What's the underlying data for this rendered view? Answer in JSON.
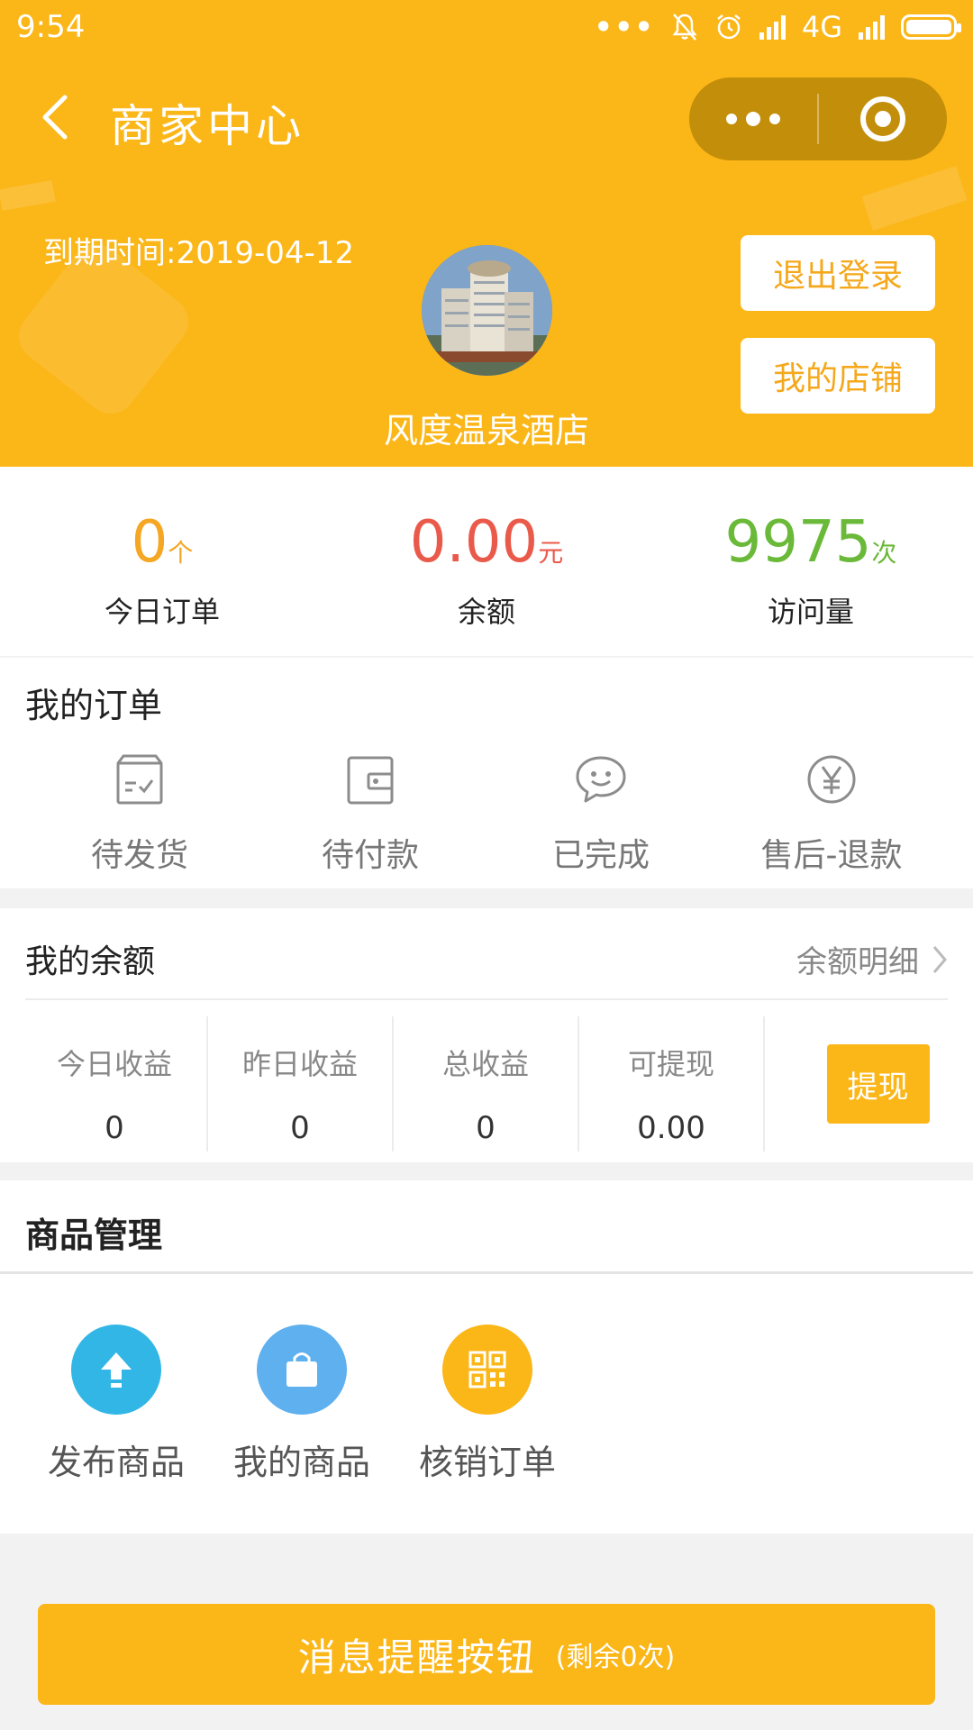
{
  "status_bar": {
    "time": "9:54",
    "network": "4G",
    "icons": [
      "more-dots-icon",
      "mute-icon",
      "alarm-icon",
      "signal-icon",
      "signal-icon",
      "battery-icon"
    ]
  },
  "nav": {
    "title": "商家中心",
    "back_icon": "chevron-left-icon",
    "more_icon": "more-dots-icon",
    "close_icon": "target-icon"
  },
  "header": {
    "expire_text": "到期时间:2019-04-12",
    "shop_name": "风度温泉酒店",
    "logout_label": "退出登录",
    "my_shop_label": "我的店铺",
    "brand_color": "#fbb618"
  },
  "stats": [
    {
      "value": "0",
      "unit": "个",
      "label": "今日订单",
      "color": "#f5a623"
    },
    {
      "value": "0.00",
      "unit": "元",
      "label": "余额",
      "color": "#ea5a4b"
    },
    {
      "value": "9975",
      "unit": "次",
      "label": "访问量",
      "color": "#6ab939"
    }
  ],
  "orders": {
    "title": "我的订单",
    "items": [
      {
        "label": "待发货",
        "icon": "box-check-icon"
      },
      {
        "label": "待付款",
        "icon": "wallet-icon"
      },
      {
        "label": "已完成",
        "icon": "smile-chat-icon"
      },
      {
        "label": "售后-退款",
        "icon": "yen-circle-icon"
      }
    ]
  },
  "balance": {
    "title": "我的余额",
    "detail_label": "余额明细",
    "columns": [
      {
        "label": "今日收益",
        "value": "0"
      },
      {
        "label": "昨日收益",
        "value": "0"
      },
      {
        "label": "总收益",
        "value": "0"
      },
      {
        "label": "可提现",
        "value": "0.00"
      }
    ],
    "withdraw_label": "提现"
  },
  "goods": {
    "title": "商品管理",
    "items": [
      {
        "label": "发布商品",
        "icon": "upload-arrow-icon"
      },
      {
        "label": "我的商品",
        "icon": "shopping-bag-icon"
      },
      {
        "label": "核销订单",
        "icon": "qr-code-icon"
      }
    ]
  },
  "message_button": {
    "label": "消息提醒按钮",
    "remaining": "(剩余0次)"
  }
}
